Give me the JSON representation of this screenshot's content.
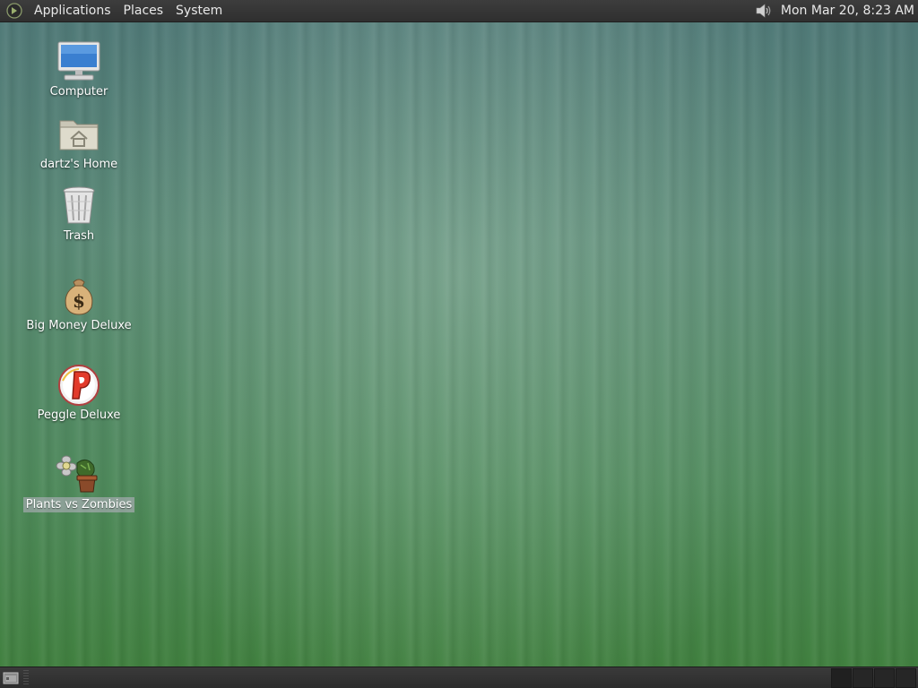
{
  "top_panel": {
    "menus": {
      "applications": "Applications",
      "places": "Places",
      "system": "System"
    },
    "clock": "Mon Mar 20,  8:23 AM",
    "icons": [
      "gnome-foot-icon",
      "speaker-volume-icon"
    ]
  },
  "desktop": {
    "icons": {
      "computer": {
        "label": "Computer",
        "icon": "computer-monitor-icon"
      },
      "home": {
        "label": "dartz's Home",
        "icon": "home-folder-icon"
      },
      "trash": {
        "label": "Trash",
        "icon": "trash-can-icon"
      },
      "bigmoney": {
        "label": "Big Money Deluxe",
        "icon": "money-bag-icon"
      },
      "peggle": {
        "label": "Peggle Deluxe",
        "icon": "peggle-p-icon"
      },
      "pvz": {
        "label": "Plants vs Zombies",
        "icon": "plants-zombies-icon",
        "selected": true
      }
    }
  },
  "bottom_panel": {
    "icons": [
      "show-desktop-icon"
    ],
    "workspace_count": 4
  },
  "colors": {
    "panel": "#333333",
    "desktop_top": "#4f7878",
    "desktop_bottom": "#3f7f3c"
  }
}
